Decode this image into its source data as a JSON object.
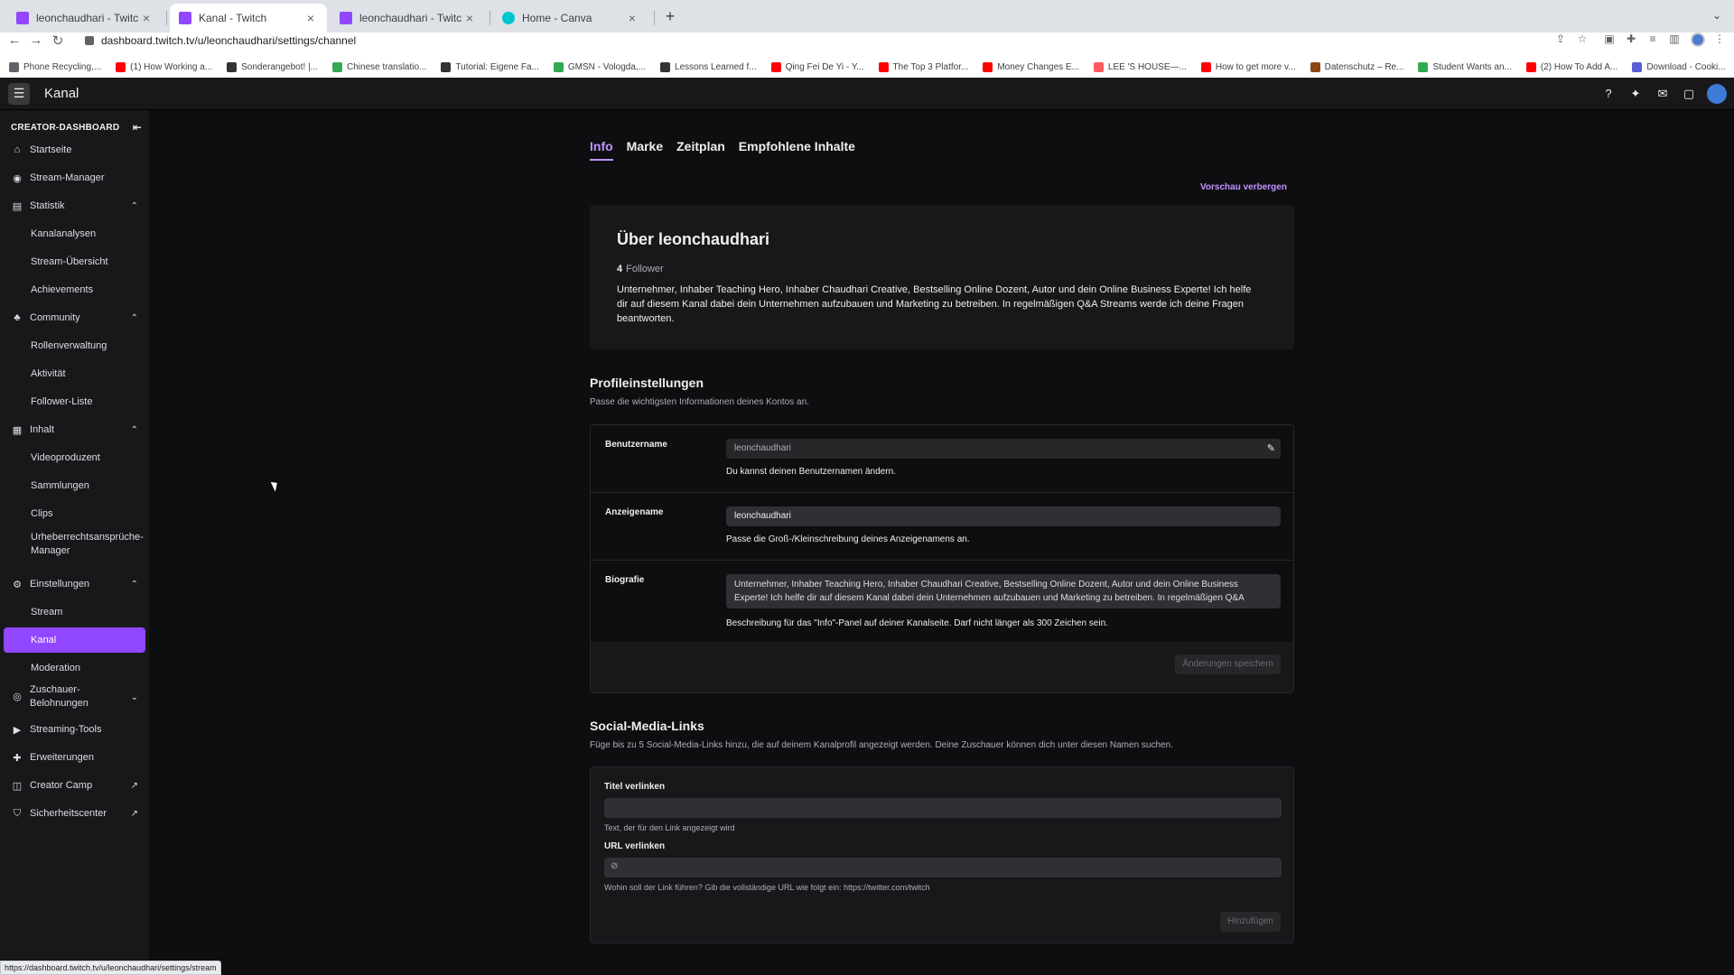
{
  "browser": {
    "tabs": [
      {
        "title": "leonchaudhari - Twitch",
        "icon": "twitch-icon"
      },
      {
        "title": "Kanal - Twitch",
        "icon": "twitch-icon"
      },
      {
        "title": "leonchaudhari - Twitch",
        "icon": "twitch-icon"
      },
      {
        "title": "Home - Canva",
        "icon": "canva-icon"
      }
    ],
    "new_tab": "+",
    "url": "dashboard.twitch.tv/u/leonchaudhari/settings/channel",
    "bookmarks": [
      {
        "label": "Phone Recycling,...",
        "color": "#5f6368"
      },
      {
        "label": "(1) How Working a...",
        "color": "#ff0000"
      },
      {
        "label": "Sonderangebot! |...",
        "color": "#333333"
      },
      {
        "label": "Chinese translatio...",
        "color": "#34a853"
      },
      {
        "label": "Tutorial: Eigene Fa...",
        "color": "#333333"
      },
      {
        "label": "GMSN - Vologda,...",
        "color": "#34a853"
      },
      {
        "label": "Lessons Learned f...",
        "color": "#333333"
      },
      {
        "label": "Qing Fei De Yi - Y...",
        "color": "#ff0000"
      },
      {
        "label": "The Top 3 Platfor...",
        "color": "#ff0000"
      },
      {
        "label": "Money Changes E...",
        "color": "#ff0000"
      },
      {
        "label": "LEE 'S HOUSE—...",
        "color": "#ff5a5f"
      },
      {
        "label": "How to get more v...",
        "color": "#ff0000"
      },
      {
        "label": "Datenschutz – Re...",
        "color": "#8b4513"
      },
      {
        "label": "Student Wants an...",
        "color": "#34a853"
      },
      {
        "label": "(2) How To Add A...",
        "color": "#ff0000"
      },
      {
        "label": "Download - Cooki...",
        "color": "#5b5bd6"
      }
    ],
    "status_url": "https://dashboard.twitch.tv/u/leonchaudhari/settings/stream"
  },
  "header": {
    "title": "Kanal"
  },
  "sidebar": {
    "heading": "CREATOR-DASHBOARD",
    "items": [
      {
        "label": "Startseite",
        "icon": "home-icon"
      },
      {
        "label": "Stream-Manager",
        "icon": "broadcast-icon"
      },
      {
        "label": "Statistik",
        "icon": "chart-icon"
      },
      {
        "label": "Kanalanalysen"
      },
      {
        "label": "Stream-Übersicht"
      },
      {
        "label": "Achievements"
      },
      {
        "label": "Community",
        "icon": "community-icon"
      },
      {
        "label": "Rollenverwaltung"
      },
      {
        "label": "Aktivität"
      },
      {
        "label": "Follower-Liste"
      },
      {
        "label": "Inhalt",
        "icon": "content-icon"
      },
      {
        "label": "Videoproduzent"
      },
      {
        "label": "Sammlungen"
      },
      {
        "label": "Clips"
      },
      {
        "label": "Urheberrechtsansprüche-Manager"
      },
      {
        "label": "Einstellungen",
        "icon": "gear-icon"
      },
      {
        "label": "Stream"
      },
      {
        "label": "Kanal"
      },
      {
        "label": "Moderation"
      },
      {
        "label": "Zuschauer-Belohnungen",
        "icon": "reward-icon"
      },
      {
        "label": "Streaming-Tools",
        "icon": "camera-icon"
      },
      {
        "label": "Erweiterungen",
        "icon": "puzzle-icon"
      },
      {
        "label": "Creator Camp",
        "icon": "book-icon"
      },
      {
        "label": "Sicherheitscenter",
        "icon": "shield-icon"
      }
    ]
  },
  "main": {
    "tabs": [
      "Info",
      "Marke",
      "Zeitplan",
      "Empfohlene Inhalte"
    ],
    "preview_toggle": "Vorschau verbergen",
    "about": {
      "title": "Über leonchaudhari",
      "follower_count": "4",
      "follower_label": "Follower",
      "bio": "Unternehmer, Inhaber Teaching Hero, Inhaber Chaudhari Creative, Bestselling Online Dozent, Autor und dein Online Business Experte! Ich helfe dir auf diesem Kanal dabei dein Unternehmen aufzubauen und Marketing zu betreiben. In regelmäßigen Q&A Streams werde ich deine Fragen beantworten."
    },
    "profile": {
      "title": "Profileinstellungen",
      "subtitle": "Passe die wichtigsten Informationen deines Kontos an.",
      "username_label": "Benutzername",
      "username_value": "leonchaudhari",
      "username_help": "Du kannst deinen Benutzernamen ändern.",
      "display_label": "Anzeigename",
      "display_value": "leonchaudhari",
      "display_help": "Passe die Groß-/Kleinschreibung deines Anzeigenamens an.",
      "bio_label": "Biografie",
      "bio_value": "Unternehmer, Inhaber Teaching Hero, Inhaber Chaudhari Creative, Bestselling Online Dozent, Autor und dein Online Business Experte! Ich helfe dir auf diesem Kanal dabei dein Unternehmen aufzubauen und Marketing zu betreiben. In regelmäßigen Q&A",
      "bio_help": "Beschreibung für das \"Info\"-Panel auf deiner Kanalseite. Darf nicht länger als 300 Zeichen sein.",
      "save_label": "Änderungen speichern"
    },
    "social": {
      "title": "Social-Media-Links",
      "subtitle": "Füge bis zu 5 Social-Media-Links hinzu, die auf deinem Kanalprofil angezeigt werden. Deine Zuschauer können dich unter diesen Namen suchen.",
      "link_title_label": "Titel verlinken",
      "link_title_help": "Text, der für den Link angezeigt wird",
      "link_url_label": "URL verlinken",
      "link_url_help": "Wohin soll der Link führen? Gib die vollständige URL wie folgt ein: https://twitter.com/twitch",
      "add_label": "Hinzufügen"
    }
  }
}
